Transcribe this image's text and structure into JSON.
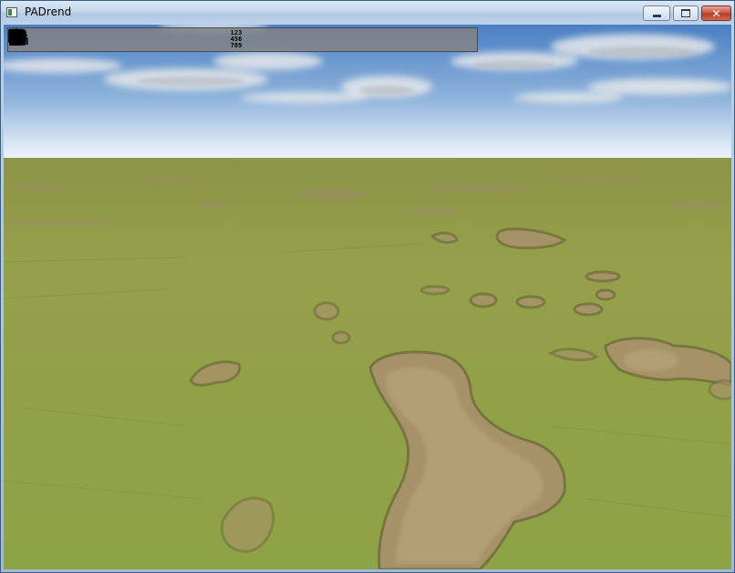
{
  "window": {
    "title": "PADrend",
    "controls": {
      "minimize": "minimize",
      "maximize": "maximize",
      "close": "✕"
    }
  },
  "toolbar": {
    "left_group": [
      {
        "name": "folder-icon",
        "tooltip": ""
      },
      {
        "name": "scene-tree-icon",
        "tooltip": ""
      },
      {
        "name": "puzzle-plugin-icon",
        "tooltip": ""
      },
      {
        "name": "document-list-icon",
        "tooltip": ""
      },
      {
        "name": "gear-icon",
        "tooltip": ""
      },
      {
        "name": "tools-icon",
        "tooltip": ""
      },
      {
        "name": "sun-cloud-icon",
        "tooltip": ""
      },
      {
        "name": "star-icon",
        "tooltip": ""
      }
    ],
    "right_group": [
      {
        "name": "numpad-icon",
        "text": "123\n456\n789"
      },
      {
        "name": "camera-icon"
      },
      {
        "name": "move-icon"
      },
      {
        "name": "rotate-icon"
      },
      {
        "name": "scale-icon"
      },
      {
        "name": "snap-plane-icon"
      },
      {
        "name": "anchor-icon"
      },
      {
        "name": "measure-icon"
      },
      {
        "name": "notes-icon"
      }
    ]
  },
  "scene": {
    "sky_color_top": "#4b80c4",
    "sky_color_horizon": "#e8f1f8",
    "grass_color": "#8c9b44",
    "dirt_color": "#a89468"
  }
}
